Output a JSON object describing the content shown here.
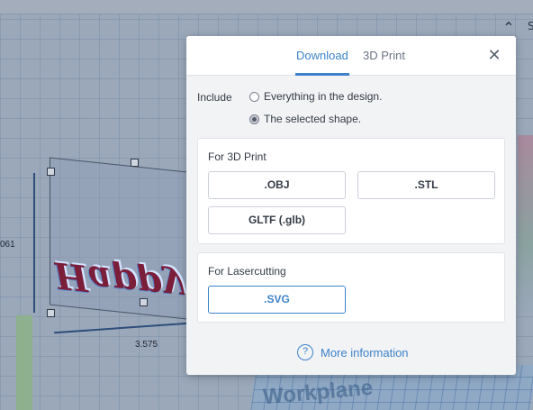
{
  "background": {
    "dimension_left": "061",
    "dimension_bottom": "3.575",
    "design_text": "Happy Valentine's Day",
    "workplane_label": "Workplane",
    "corner_letter": "S"
  },
  "modal": {
    "tabs": [
      {
        "label": "Download",
        "active": true
      },
      {
        "label": "3D Print",
        "active": false
      }
    ],
    "close_icon": "close-icon",
    "include": {
      "label": "Include",
      "options": [
        {
          "label": "Everything in the design.",
          "selected": false
        },
        {
          "label": "The selected shape.",
          "selected": true
        }
      ]
    },
    "sections": {
      "print3d": {
        "title": "For 3D Print",
        "buttons": [
          ".OBJ",
          ".STL",
          "GLTF (.glb)"
        ]
      },
      "laser": {
        "title": "For Lasercutting",
        "buttons": [
          ".SVG"
        ]
      }
    },
    "more_info": "More information",
    "help_icon_glyph": "?"
  },
  "colors": {
    "accent": "#3d83c9",
    "modal_bg": "#f2f3f5"
  }
}
